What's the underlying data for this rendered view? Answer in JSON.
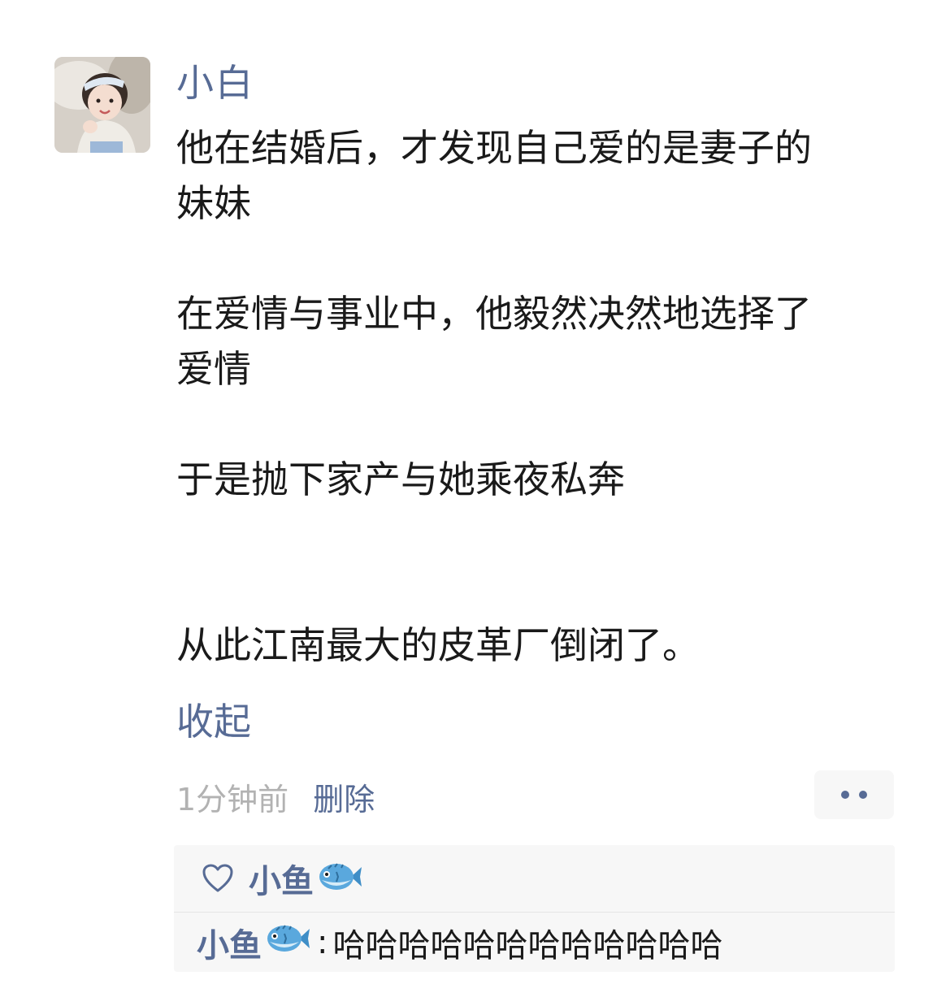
{
  "post": {
    "author": "小白",
    "paragraphs": [
      [
        "他在结婚后，才发现自己爱的是妻子的",
        "妹妹"
      ],
      [
        "在爱情与事业中，他毅然决然地选择了",
        "爱情"
      ],
      [
        "于是抛下家产与她乘夜私奔"
      ],
      [
        "从此江南最大的皮革厂倒闭了。"
      ]
    ],
    "collapse_label": "收起",
    "time": "1分钟前",
    "delete_label": "删除"
  },
  "likes": {
    "names": [
      "小鱼"
    ]
  },
  "comments": [
    {
      "author": "小鱼",
      "separator": ":",
      "text": "哈哈哈哈哈哈哈哈哈哈哈哈"
    }
  ],
  "icons": {
    "heart": "heart-outline-icon",
    "fish": "blowfish-emoji-icon",
    "more": "more-dots-icon"
  },
  "colors": {
    "link": "#576b95",
    "text": "#1a1a1a",
    "muted": "#b2b2b2",
    "panel": "#f7f7f7"
  }
}
